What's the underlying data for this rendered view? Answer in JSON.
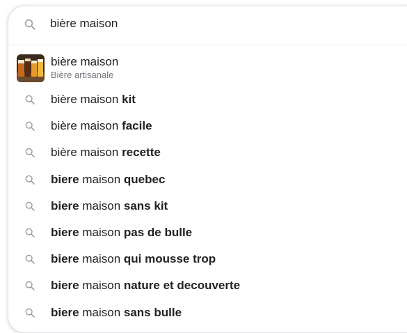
{
  "search": {
    "query": "bière maison",
    "icon": "search-icon"
  },
  "suggestions": {
    "rich": {
      "title": "bière maison",
      "subtitle": "Bière artisanale",
      "thumbnail": "beer-glasses-thumbnail"
    },
    "items": [
      {
        "parts": [
          {
            "t": "bière maison ",
            "b": false
          },
          {
            "t": "kit",
            "b": true
          }
        ]
      },
      {
        "parts": [
          {
            "t": "bière maison ",
            "b": false
          },
          {
            "t": "facile",
            "b": true
          }
        ]
      },
      {
        "parts": [
          {
            "t": "bière maison ",
            "b": false
          },
          {
            "t": "recette",
            "b": true
          }
        ]
      },
      {
        "parts": [
          {
            "t": "biere",
            "b": true
          },
          {
            "t": " maison ",
            "b": false
          },
          {
            "t": "quebec",
            "b": true
          }
        ]
      },
      {
        "parts": [
          {
            "t": "biere",
            "b": true
          },
          {
            "t": " maison ",
            "b": false
          },
          {
            "t": "sans kit",
            "b": true
          }
        ]
      },
      {
        "parts": [
          {
            "t": "biere",
            "b": true
          },
          {
            "t": " maison ",
            "b": false
          },
          {
            "t": "pas de bulle",
            "b": true
          }
        ]
      },
      {
        "parts": [
          {
            "t": "biere",
            "b": true
          },
          {
            "t": " maison ",
            "b": false
          },
          {
            "t": "qui mousse trop",
            "b": true
          }
        ]
      },
      {
        "parts": [
          {
            "t": "biere",
            "b": true
          },
          {
            "t": " maison ",
            "b": false
          },
          {
            "t": "nature et decouverte",
            "b": true
          }
        ]
      },
      {
        "parts": [
          {
            "t": "biere",
            "b": true
          },
          {
            "t": " maison ",
            "b": false
          },
          {
            "t": "sans bulle",
            "b": true
          }
        ]
      }
    ]
  },
  "colors": {
    "text": "#202124",
    "secondary": "#70757a",
    "icon": "#9aa0a6",
    "border": "#dfe1e5"
  }
}
